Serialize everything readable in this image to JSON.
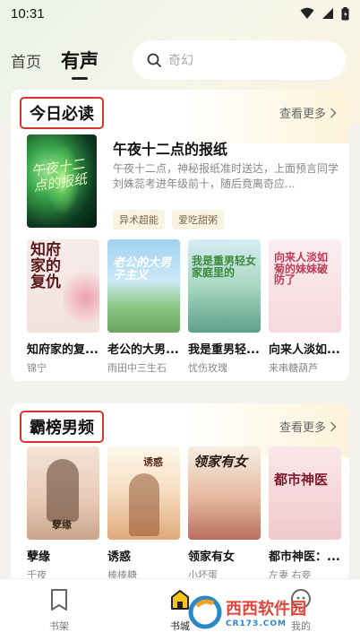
{
  "status_bar": {
    "time": "10:31"
  },
  "top_nav": {
    "tabs": [
      {
        "label": "首页"
      },
      {
        "label": "有声"
      }
    ],
    "search": {
      "placeholder": "奇幻"
    }
  },
  "section1": {
    "title": "今日必读",
    "more": "查看更多",
    "feature": {
      "title": "午夜十二点的报纸",
      "description": "午夜十二点，神秘报纸准时送达，上面预言同学刘姝蕊考进年级前十，随后竟离奇应...",
      "cover_text": "午夜十二点的报纸",
      "tags": [
        "异术超能",
        "爱吃甜粥"
      ]
    },
    "books": [
      {
        "title": "知府家的复...",
        "author": "锦宁",
        "cover_text": "知府家的复仇"
      },
      {
        "title": "老公的大男...",
        "author": "雨田中三生石",
        "cover_text": "老公的大男子主义"
      },
      {
        "title": "我是重男轻...",
        "author": "忧伤玫瑰",
        "cover_text": "我是重男轻女家庭里的"
      },
      {
        "title": "向来人淡如...",
        "author": "来串糖葫芦",
        "cover_text": "向来人淡如菊的妹妹破防了"
      }
    ]
  },
  "section2": {
    "title": "霸榜男频",
    "more": "查看更多",
    "books": [
      {
        "title": "孽缘",
        "author": "千夜",
        "cover_text": "孽缘"
      },
      {
        "title": "诱惑",
        "author": "棒棒糖",
        "cover_text": "诱惑"
      },
      {
        "title": "领家有女",
        "author": "小坏蛋",
        "cover_text": "领家有女"
      },
      {
        "title": "都市神医：...",
        "author": "左妻 右妾",
        "cover_text": "都市神医"
      }
    ]
  },
  "bottom_nav": {
    "items": [
      {
        "label": "书架"
      },
      {
        "label": "书城"
      },
      {
        "label": "我的"
      }
    ]
  },
  "watermark": {
    "text": "西西软件园",
    "sub": "CR173.COM"
  }
}
